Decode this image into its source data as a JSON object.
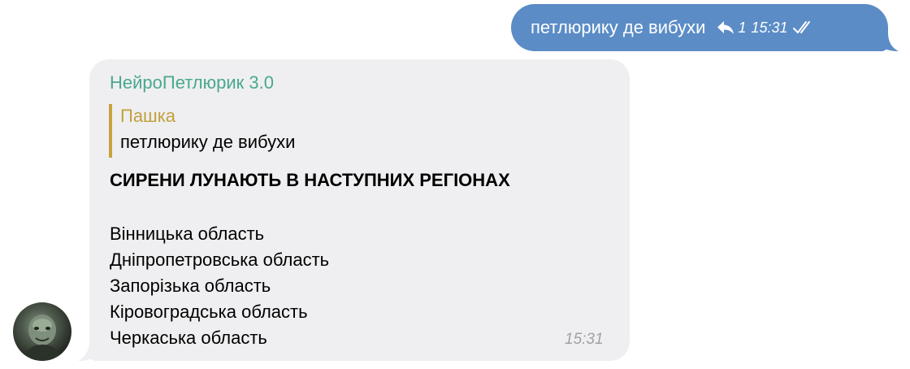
{
  "outgoing": {
    "text": "петлюрику де вибухи",
    "reply_count": "1",
    "time": "15:31",
    "status_icon": "double-check-icon",
    "reply_icon": "reply-arrow-icon",
    "bubble_color": "#5b8cc6"
  },
  "incoming": {
    "sender": "НейроПетлюрик 3.0",
    "sender_color": "#4aa88e",
    "quote": {
      "author": "Пашка",
      "text": "петлюрику де вибухи",
      "bar_color": "#c8a23c"
    },
    "headline": "СИРЕНИ ЛУНАЮТЬ В НАСТУПНИХ РЕГІОНАХ",
    "regions": [
      "Вінницька область",
      "Дніпропетровська область",
      "Запорізька область",
      "Кіровоградська область",
      "Черкаська область"
    ],
    "time": "15:31",
    "bubble_color": "#efeff1",
    "avatar_icon": "bot-avatar"
  }
}
